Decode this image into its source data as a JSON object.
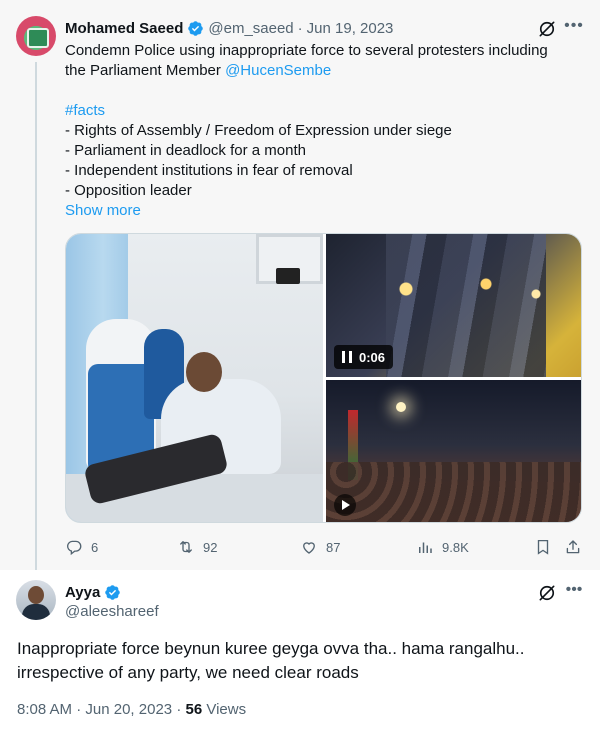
{
  "colors": {
    "accent": "#1d9bf0",
    "verified": "#1d9bf0",
    "muted_text": "#536471",
    "primary_text": "#0f1419"
  },
  "tweet1": {
    "author_name": "Mohamed Saeed",
    "handle": "@em_saeed",
    "separator": "·",
    "date": "Jun 19, 2023",
    "more_icon": "more-horizontal-icon",
    "grok_icon": "grok-icon",
    "text_line1": "Condemn Police using inappropriate force to several protesters including",
    "text_line2_prefix": "the Parliament Member ",
    "mention": "@HucenSembe",
    "hashtag": "#facts",
    "bullets": [
      "- Rights of Assembly / Freedom of Expression under siege",
      "- Parliament in deadlock for a month",
      "- Independent institutions in fear of removal",
      "- Opposition leader"
    ],
    "show_more": "Show more",
    "video_duration": "0:06",
    "actions": {
      "replies": "6",
      "reposts": "92",
      "likes": "87",
      "views": "9.8K"
    }
  },
  "tweet2": {
    "author_name": "Ayya",
    "handle": "@aleeshareef",
    "text_line1": "Inappropriate force beynun kuree geyga ovva tha.. hama rangalhu..",
    "text_line2": "irrespective of any party, we need clear roads",
    "time": "8:08 AM",
    "separator": "·",
    "date": "Jun 20, 2023",
    "separator2": "·",
    "views_count": "56",
    "views_label": "Views"
  }
}
